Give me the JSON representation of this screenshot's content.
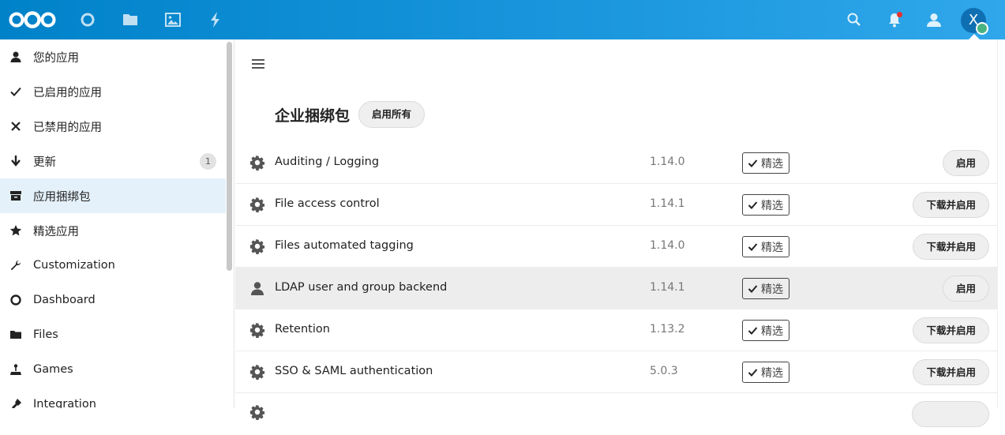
{
  "header": {
    "nav_icons": [
      "dashboard-icon",
      "files-icon",
      "photos-icon",
      "activity-icon"
    ],
    "right_icons": [
      "search-icon",
      "notifications-icon",
      "contacts-icon"
    ],
    "avatar_initial": "X",
    "brand_color": "#0082c9"
  },
  "sidebar": {
    "items": [
      {
        "label": "您的应用",
        "icon": "user-icon"
      },
      {
        "label": "已启用的应用",
        "icon": "check-icon"
      },
      {
        "label": "已禁用的应用",
        "icon": "close-icon"
      },
      {
        "label": "更新",
        "icon": "download-icon",
        "badge": "1"
      },
      {
        "label": "应用捆绑包",
        "icon": "archive-icon",
        "active": true
      },
      {
        "label": "精选应用",
        "icon": "star-icon"
      },
      {
        "label": "Customization",
        "icon": "wrench-icon"
      },
      {
        "label": "Dashboard",
        "icon": "circle-icon"
      },
      {
        "label": "Files",
        "icon": "folder-icon"
      },
      {
        "label": "Games",
        "icon": "joystick-icon"
      },
      {
        "label": "Integration",
        "icon": "plug-icon"
      }
    ]
  },
  "main": {
    "section_title": "企业捆绑包",
    "enable_all_label": "启用所有",
    "featured_label": "精选",
    "apps": [
      {
        "name": "Auditing / Logging",
        "version": "1.14.0",
        "action": "启用",
        "icon": "gear-icon"
      },
      {
        "name": "File access control",
        "version": "1.14.1",
        "action": "下载并启用",
        "icon": "gear-icon"
      },
      {
        "name": "Files automated tagging",
        "version": "1.14.0",
        "action": "下载并启用",
        "icon": "gear-icon"
      },
      {
        "name": "LDAP user and group backend",
        "version": "1.14.1",
        "action": "启用",
        "icon": "user-icon",
        "highlight": true
      },
      {
        "name": "Retention",
        "version": "1.13.2",
        "action": "下载并启用",
        "icon": "gear-icon"
      },
      {
        "name": "SSO & SAML authentication",
        "version": "5.0.3",
        "action": "下载并启用",
        "icon": "gear-icon"
      }
    ]
  }
}
